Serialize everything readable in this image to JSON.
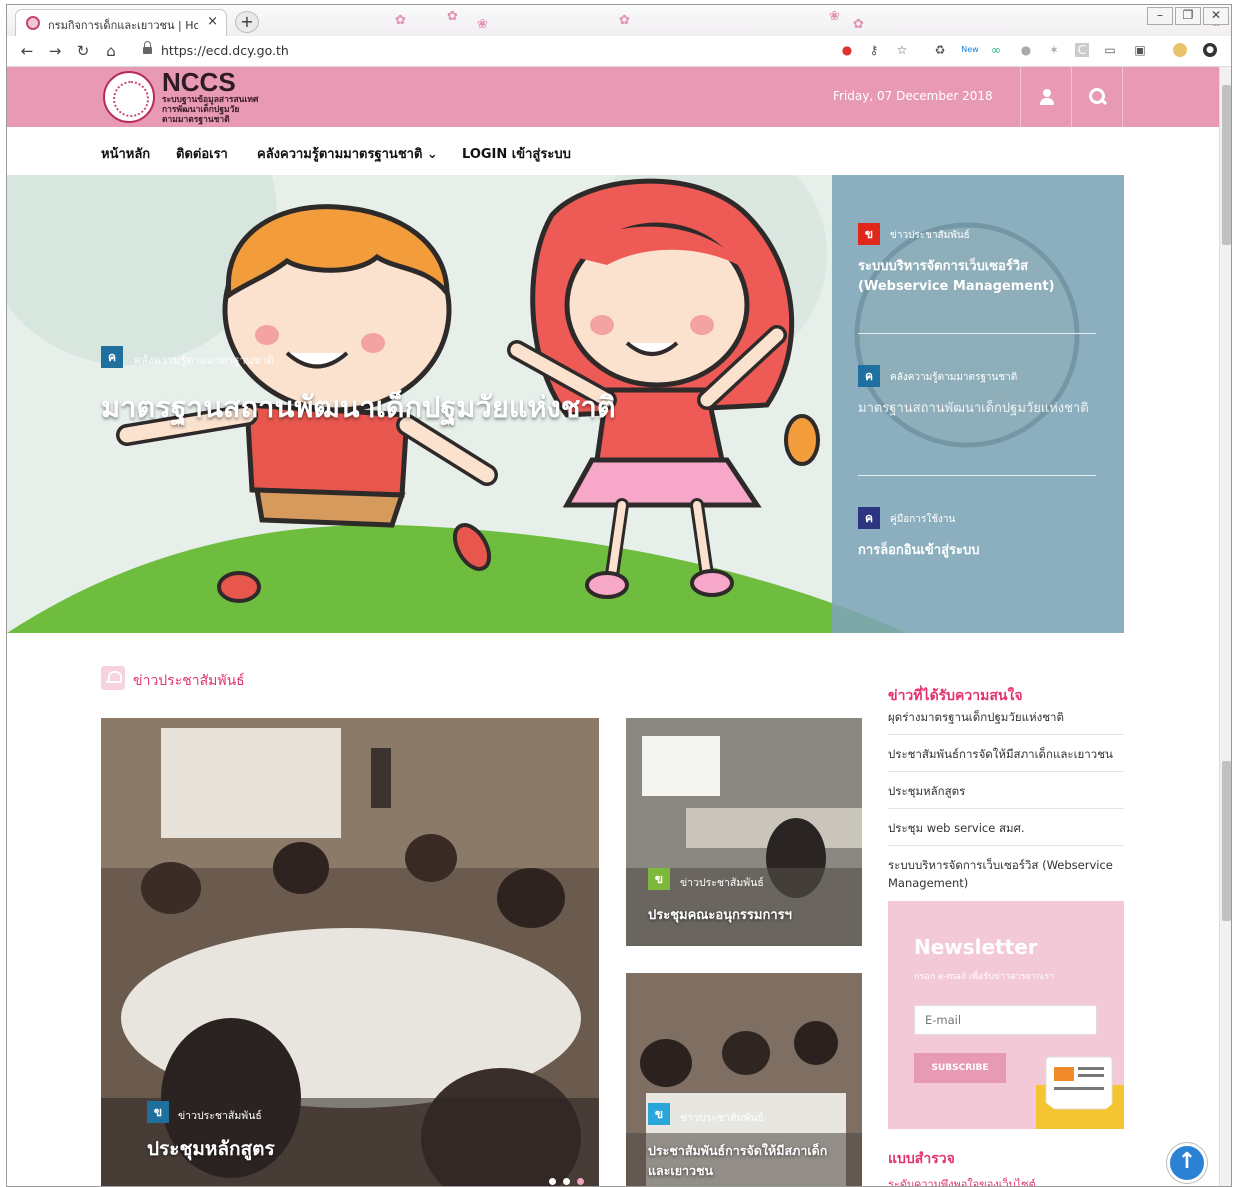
{
  "browser": {
    "tab_title": "กรมกิจการเด็กและเยาวชน | Home",
    "tab_close": "×",
    "new_tab": "+",
    "url": "https://ecd.dcy.go.th",
    "ext_new_badge": "New"
  },
  "header": {
    "logo_name": "NCCS",
    "logo_sub": [
      "ระบบฐานข้อมูลสารสนเทศ",
      "การพัฒนาเด็กปฐมวัย",
      "ตามมาตรฐานชาติ"
    ],
    "date": "Friday, 07 December 2018"
  },
  "nav": {
    "items": [
      "หน้าหลัก",
      "ติดต่อเรา",
      "คลังความรู้ตามมาตรฐานชาติ",
      "LOGIN เข้าสู่ระบบ"
    ],
    "dropdown_mark": "⌄"
  },
  "hero": {
    "badge": "ค",
    "category": "คลังความรู้ตามมาตรฐานชาติ",
    "title": "มาตรฐานสถานพัฒนาเด็กปฐมวัยแห่งชาติ",
    "side_items": [
      {
        "badge": "ข",
        "badge_color": "#e1261c",
        "category": "ข่าวประชาสัมพันธ์",
        "title": "ระบบบริหารจัดการเว็บเซอร์วิส (Webservice Management)"
      },
      {
        "badge": "ค",
        "badge_color": "#1f6f9f",
        "category": "คลังความรู้ตามมาตรฐานชาติ",
        "title": "มาตรฐานสถานพัฒนาเด็กปฐมวัยแห่งชาติ"
      },
      {
        "badge": "ค",
        "badge_color": "#2c3580",
        "category": "คู่มือการใช้งาน",
        "title": "การล็อกอินเข้าสู่ระบบ"
      }
    ]
  },
  "news": {
    "section_title": "ข่าวประชาสัมพันธ์",
    "cards": [
      {
        "badge": "ข",
        "badge_color": "#1f6f9f",
        "category": "ข่าวประชาสัมพันธ์",
        "title": "ประชุมหลักสูตร"
      },
      {
        "badge": "ข",
        "badge_color": "#7db83a",
        "category": "ข่าวประชาสัมพันธ์",
        "title": "ประชุมคณะอนุกรรมการฯ"
      },
      {
        "badge": "ข",
        "badge_color": "#2aa6d8",
        "category": "ข่าวประชาสัมพันธ์",
        "title": "ประชาสัมพันธ์การจัดให้มีสภาเด็กและเยาวชน"
      }
    ]
  },
  "sidebar": {
    "popular_title": "ข่าวที่ได้รับความสนใจ",
    "popular": [
      "ผุดร่างมาตรฐานเด็กปฐมวัยแห่งชาติ",
      "ประชาสัมพันธ์การจัดให้มีสภาเด็กและเยาวชน",
      "ประชุมหลักสูตร",
      "ประชุม web service สมศ.",
      "ระบบบริหารจัดการเว็บเซอร์วิส (Webservice Management)"
    ],
    "newsletter": {
      "title": "Newsletter",
      "subtitle": "กรอก e-mail เพื่อรับข่าวสารจากเรา",
      "placeholder": "E-mail",
      "button": "SUBSCRIBE"
    },
    "survey_title": "แบบสำรวจ",
    "survey_link": "ระดับความพึงพอใจของเว็บไซต์"
  },
  "colors": {
    "accent": "#e1346f",
    "header": "#e89ab4",
    "scroll_top": "#2b82d4"
  },
  "icons": [
    "favicon",
    "close-icon",
    "back-icon",
    "forward-icon",
    "reload-icon",
    "home-icon",
    "lock-icon",
    "star-icon",
    "user-icon",
    "search-icon",
    "bell-icon",
    "envelope-icon",
    "arrow-up-icon"
  ],
  "scroll_top": "↑"
}
